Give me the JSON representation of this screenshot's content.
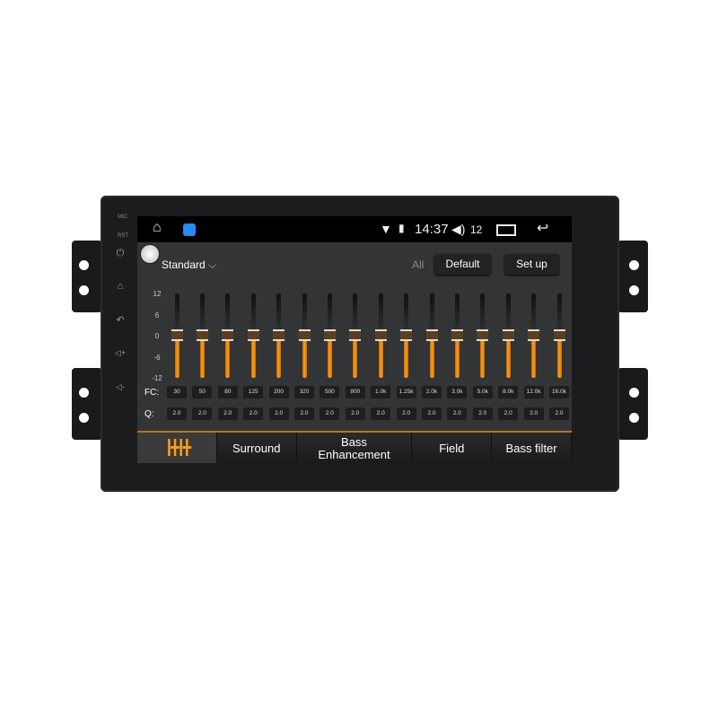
{
  "bezel": {
    "mic_label": "MIC",
    "rst_label": "RST",
    "icons": [
      "power-icon",
      "home-icon",
      "back-icon",
      "volume-up-icon",
      "volume-down-icon"
    ]
  },
  "status_bar": {
    "time": "14:37",
    "volume_level": "12",
    "icons": [
      "home-icon",
      "app-icon",
      "wifi-icon",
      "sim-icon",
      "volume-icon",
      "recent-apps-icon",
      "back-icon"
    ]
  },
  "header": {
    "preset": "Standard",
    "all_label": "All",
    "default_button": "Default",
    "setup_button": "Set up"
  },
  "eq": {
    "scale": [
      "12",
      "6",
      "0",
      "-6",
      "-12"
    ],
    "fc_label": "FC:",
    "q_label": "Q:",
    "bands": [
      {
        "fc": "30",
        "q": "2.0",
        "gain": 0
      },
      {
        "fc": "50",
        "q": "2.0",
        "gain": 0
      },
      {
        "fc": "80",
        "q": "2.0",
        "gain": 0
      },
      {
        "fc": "125",
        "q": "2.0",
        "gain": 0
      },
      {
        "fc": "200",
        "q": "2.0",
        "gain": 0
      },
      {
        "fc": "320",
        "q": "2.0",
        "gain": 0
      },
      {
        "fc": "500",
        "q": "2.0",
        "gain": 0
      },
      {
        "fc": "800",
        "q": "2.0",
        "gain": 0
      },
      {
        "fc": "1.0k",
        "q": "2.0",
        "gain": 0
      },
      {
        "fc": "1.25k",
        "q": "2.0",
        "gain": 0
      },
      {
        "fc": "2.0k",
        "q": "2.0",
        "gain": 0
      },
      {
        "fc": "3.0k",
        "q": "2.0",
        "gain": 0
      },
      {
        "fc": "5.0k",
        "q": "2.0",
        "gain": 0
      },
      {
        "fc": "8.0k",
        "q": "2.0",
        "gain": 0
      },
      {
        "fc": "12.0k",
        "q": "2.0",
        "gain": 0
      },
      {
        "fc": "16.0k",
        "q": "2.0",
        "gain": 0
      }
    ]
  },
  "tabs": [
    {
      "label": "",
      "icon": "equalizer-icon",
      "active": true
    },
    {
      "label": "Surround"
    },
    {
      "label": "Bass Enhancement"
    },
    {
      "label": "Field"
    },
    {
      "label": "Bass filter"
    }
  ],
  "colors": {
    "accent": "#ff9d1a",
    "screen_bg": "#333436"
  }
}
